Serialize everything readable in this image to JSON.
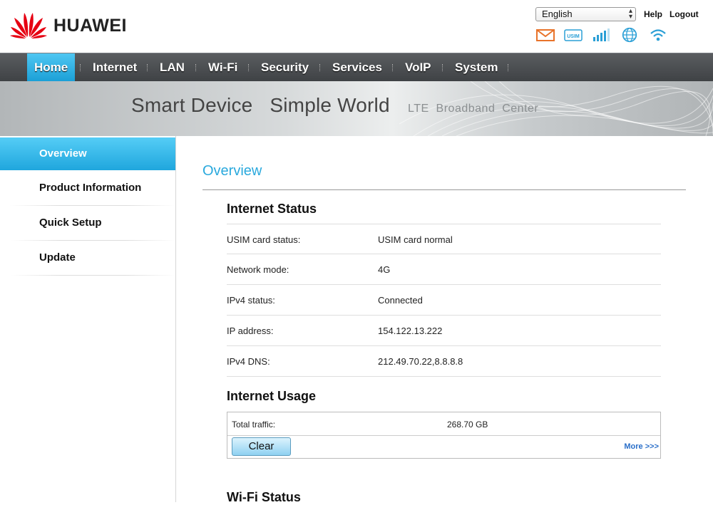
{
  "header": {
    "brand": "HUAWEI",
    "language": "English",
    "help": "Help",
    "logout": "Logout",
    "status_icons": [
      "mail-icon",
      "usim-icon",
      "signal-icon",
      "globe-icon",
      "wifi-icon"
    ],
    "usim_label": "USIM"
  },
  "nav": {
    "items": [
      {
        "label": "Home",
        "active": true
      },
      {
        "label": "Internet"
      },
      {
        "label": "LAN"
      },
      {
        "label": "Wi-Fi"
      },
      {
        "label": "Security"
      },
      {
        "label": "Services"
      },
      {
        "label": "VoIP"
      },
      {
        "label": "System"
      }
    ]
  },
  "banner": {
    "slogan_main": "Smart Device   Simple World",
    "slogan_sub": "LTE  Broadband  Center"
  },
  "sidebar": {
    "items": [
      {
        "label": "Overview",
        "active": true
      },
      {
        "label": "Product Information"
      },
      {
        "label": "Quick Setup"
      },
      {
        "label": "Update"
      }
    ]
  },
  "main": {
    "title": "Overview",
    "internet_status": {
      "title": "Internet Status",
      "rows": [
        {
          "key": "USIM card status:",
          "value": "USIM card normal"
        },
        {
          "key": "Network mode:",
          "value": "4G"
        },
        {
          "key": "IPv4 status:",
          "value": "Connected"
        },
        {
          "key": "IP address:",
          "value": "154.122.13.222"
        },
        {
          "key": "IPv4 DNS:",
          "value": "212.49.70.22,8.8.8.8"
        }
      ]
    },
    "internet_usage": {
      "title": "Internet Usage",
      "total_key": "Total traffic:",
      "total_value": "268.70 GB",
      "clear_label": "Clear",
      "more_label": "More >>>"
    },
    "wifi_status": {
      "title": "Wi-Fi Status"
    }
  },
  "colors": {
    "accent": "#2aa9dd",
    "nav_bg": "#4a4d50",
    "brand_red": "#e60012"
  }
}
